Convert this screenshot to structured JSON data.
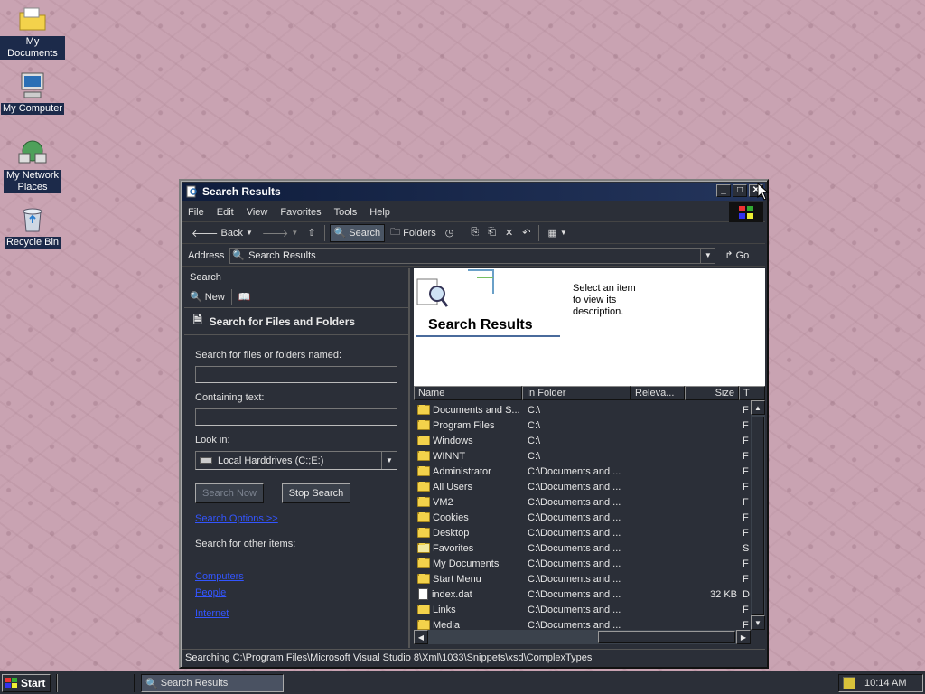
{
  "desktop": {
    "icons": [
      {
        "label": "My Documents"
      },
      {
        "label": "My Computer"
      },
      {
        "label": "My Network Places",
        "label2": "Places"
      },
      {
        "label": "Recycle Bin"
      }
    ]
  },
  "window": {
    "title": "Search Results",
    "menu": [
      "File",
      "Edit",
      "View",
      "Favorites",
      "Tools",
      "Help"
    ],
    "toolbar": {
      "back": "Back",
      "search": "Search",
      "folders": "Folders"
    },
    "address": {
      "label": "Address",
      "value": "Search Results",
      "go": "Go"
    },
    "search_pane": {
      "header": "Search",
      "new_label": "New",
      "title": "Search for Files and Folders",
      "named_label": "Search for files or folders named:",
      "named_value": "",
      "containing_label": "Containing text:",
      "containing_value": "",
      "lookin_label": "Look in:",
      "lookin_value": "Local Harddrives (C:;E:)",
      "search_now": "Search Now",
      "stop_search": "Stop Search",
      "options_link": "Search Options >>",
      "other_label": "Search for other items:",
      "links": [
        "Computers",
        "People",
        "Internet"
      ]
    },
    "banner": {
      "title": "Search Results",
      "description": "Select an item to view its description."
    },
    "columns": [
      "Name",
      "In Folder",
      "Releva...",
      "Size",
      "T"
    ],
    "rows": [
      {
        "name": "Documents and S...",
        "folder": "C:\\",
        "size": "",
        "type": "F",
        "icon": "folder"
      },
      {
        "name": "Program Files",
        "folder": "C:\\",
        "size": "",
        "type": "F",
        "icon": "folder"
      },
      {
        "name": "Windows",
        "folder": "C:\\",
        "size": "",
        "type": "F",
        "icon": "folder"
      },
      {
        "name": "WINNT",
        "folder": "C:\\",
        "size": "",
        "type": "F",
        "icon": "folder"
      },
      {
        "name": "Administrator",
        "folder": "C:\\Documents and ...",
        "size": "",
        "type": "F",
        "icon": "folder"
      },
      {
        "name": "All Users",
        "folder": "C:\\Documents and ...",
        "size": "",
        "type": "F",
        "icon": "folder"
      },
      {
        "name": "VM2",
        "folder": "C:\\Documents and ...",
        "size": "",
        "type": "F",
        "icon": "folder"
      },
      {
        "name": "Cookies",
        "folder": "C:\\Documents and ...",
        "size": "",
        "type": "F",
        "icon": "folder"
      },
      {
        "name": "Desktop",
        "folder": "C:\\Documents and ...",
        "size": "",
        "type": "F",
        "icon": "folder"
      },
      {
        "name": "Favorites",
        "folder": "C:\\Documents and ...",
        "size": "",
        "type": "S",
        "icon": "favorites"
      },
      {
        "name": "My Documents",
        "folder": "C:\\Documents and ...",
        "size": "",
        "type": "F",
        "icon": "folder"
      },
      {
        "name": "Start Menu",
        "folder": "C:\\Documents and ...",
        "size": "",
        "type": "F",
        "icon": "folder"
      },
      {
        "name": "index.dat",
        "folder": "C:\\Documents and ...",
        "size": "32 KB",
        "type": "D",
        "icon": "file"
      },
      {
        "name": "Links",
        "folder": "C:\\Documents and ...",
        "size": "",
        "type": "F",
        "icon": "folder"
      },
      {
        "name": "Media",
        "folder": "C:\\Documents and ...",
        "size": "",
        "type": "F",
        "icon": "folder"
      }
    ],
    "status": "Searching C:\\Program Files\\Microsoft Visual Studio 8\\Xml\\1033\\Snippets\\xsd\\ComplexTypes"
  },
  "taskbar": {
    "start": "Start",
    "task": "Search Results",
    "clock": "10:14 AM"
  },
  "colors": {
    "desktop": "#c9a3b2",
    "window": "#2b2f38",
    "link": "#3355ff",
    "folder": "#f3d24b"
  }
}
